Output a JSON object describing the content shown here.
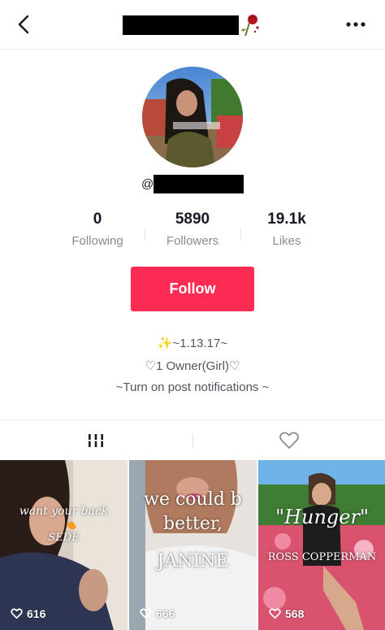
{
  "header": {
    "back_icon": "chevron-left-icon",
    "title_emoji": "🥀",
    "more_icon": "more-horizontal-icon"
  },
  "profile": {
    "handle_prefix": "@"
  },
  "stats": {
    "following": {
      "value": "0",
      "label": "Following"
    },
    "followers": {
      "value": "5890",
      "label": "Followers"
    },
    "likes": {
      "value": "19.1k",
      "label": "Likes"
    }
  },
  "follow_button": {
    "label": "Follow",
    "color": "#fe2c55"
  },
  "bio": {
    "line1": "✨~1.13.17~",
    "line2": "♡1 Owner(Girl)♡",
    "line3": "~Turn on post notifications ~"
  },
  "tabs": {
    "videos_icon": "grid-icon",
    "liked_icon": "heart-outline-icon"
  },
  "videos": [
    {
      "likes": "616",
      "overlay_lines": [
        "want your back",
        "SEDE"
      ]
    },
    {
      "likes": "666",
      "overlay_lines": [
        "we could b",
        "better,",
        "JANINE"
      ]
    },
    {
      "likes": "568",
      "overlay_lines": [
        "\"Hunger\"",
        "ROSS COPPERMAN"
      ]
    }
  ]
}
